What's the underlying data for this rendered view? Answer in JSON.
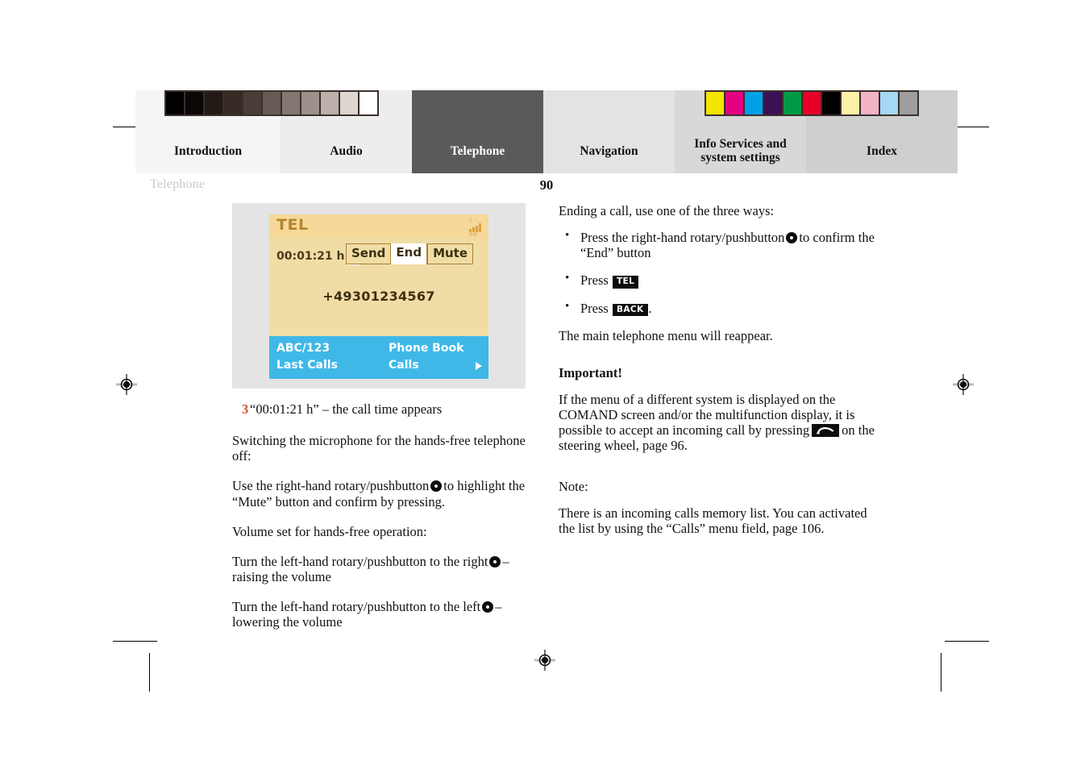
{
  "document": {
    "running_head": "Telephone",
    "page_number": "90"
  },
  "tabs": [
    {
      "label": "Introduction",
      "active": false
    },
    {
      "label": "Audio",
      "active": false
    },
    {
      "label": "Telephone",
      "active": true
    },
    {
      "label": "Navigation",
      "active": false
    },
    {
      "label": "Info Services and\nsystem settings",
      "active": false
    },
    {
      "label": "Index",
      "active": false
    }
  ],
  "tab_labels": {
    "introduction": "Introduction",
    "audio": "Audio",
    "telephone": "Telephone",
    "navigation": "Navigation",
    "info_services_line1": "Info Services and",
    "info_services_line2": "system settings",
    "index": "Index"
  },
  "color_bars": {
    "grayscale": [
      "#000000",
      "#0b0706",
      "#231a16",
      "#362a25",
      "#4a3c36",
      "#675b54",
      "#837771",
      "#9c918b",
      "#bbb0aa",
      "#dcd6d1",
      "#ffffff"
    ],
    "colors": [
      "#f2e500",
      "#e4007f",
      "#00a0e9",
      "#3c1053",
      "#009a46",
      "#e60027",
      "#000000",
      "#fdf0a8",
      "#f5b3c8",
      "#a5d8f3",
      "#9e9e9e"
    ]
  },
  "figure": {
    "caption_number": "3",
    "caption_text": "“00:01:21 h” – the call time appears",
    "lcd": {
      "header_title": "TEL",
      "signal_label_top": "s",
      "signal_label_bottom": "RM",
      "call_time": "00:01:21 h",
      "buttons": [
        "Send",
        "End",
        "Mute"
      ],
      "selected_button": "End",
      "phone_number": "+49301234567",
      "footer": {
        "top_left": "ABC/123",
        "bottom_left": "Last Calls",
        "top_right": "Phone Book",
        "bottom_right": "Calls"
      }
    }
  },
  "left_column": {
    "mic_heading": "Switching the microphone for the hands-free telephone off:",
    "mic_text_before": "Use the right-hand rotary/pushbutton",
    "mic_text_after": "to highlight the “Mute” button and confirm by pressing.",
    "volume_heading": "Volume set for hands-free operation:",
    "volume_up_before": "Turn the left-hand rotary/pushbutton to the right",
    "volume_up_after": "– raising the volume",
    "volume_down_before": "Turn the left-hand rotary/pushbutton to the left",
    "volume_down_after": "– lowering the volume"
  },
  "right_column": {
    "ending_heading": "Ending a call, use one of the three ways:",
    "bullet1_before": "Press the right-hand rotary/pushbutton",
    "bullet1_after": "to confirm the “End” button",
    "bullet2_before": "Press",
    "bullet2_key": "TEL",
    "bullet3_before": "Press",
    "bullet3_key": "BACK",
    "bullet3_after": ".",
    "after_bullets": "The main telephone menu will reappear.",
    "important_heading": "Important!",
    "important_text_before": "If the menu of a different system is displayed on the COMAND screen and/or the multifunction display, it is possible to accept an incoming call by pressing",
    "important_text_after": "on the steering wheel, page 96.",
    "note_heading": "Note:",
    "note_text": "There is an incoming calls memory list. You can activated the list by using the “Calls” menu field, page 106."
  },
  "icons": {
    "rotary_pushbutton": "rotary-pushbutton-icon",
    "tel_key": "tel-key-icon",
    "back_key": "back-key-icon",
    "phone_handset_key": "phone-handset-key-icon",
    "registration_mark": "registration-mark-icon",
    "signal_bars": "signal-bars-icon",
    "footer_arrow": "chevron-right-icon"
  },
  "colors": {
    "accent_step_number": "#d84f2a",
    "active_tab_bg": "#5a5a5a",
    "lcd_bg": "#f0dda6",
    "lcd_header_bg": "#f6d89a",
    "lcd_footer_bg": "#3fb8e8",
    "running_head": "#c9c9c9"
  }
}
